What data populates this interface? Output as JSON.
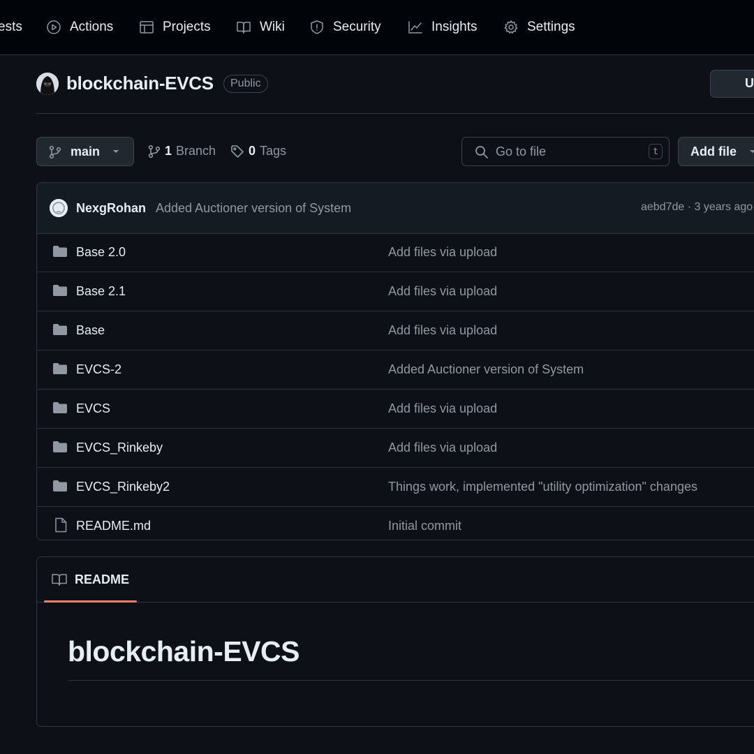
{
  "nav": {
    "items": [
      {
        "label": "ests",
        "icon": "pull-request-icon"
      },
      {
        "label": "Actions",
        "icon": "play-icon"
      },
      {
        "label": "Projects",
        "icon": "table-icon"
      },
      {
        "label": "Wiki",
        "icon": "book-icon"
      },
      {
        "label": "Security",
        "icon": "shield-icon"
      },
      {
        "label": "Insights",
        "icon": "graph-icon"
      },
      {
        "label": "Settings",
        "icon": "gear-icon"
      }
    ]
  },
  "repo": {
    "name": "blockchain-EVCS",
    "visibility": "Public",
    "pin_label": "U"
  },
  "controls": {
    "branch": "main",
    "branch_count": "1",
    "branch_label": "Branch",
    "tag_count": "0",
    "tag_label": "Tags",
    "goto_placeholder": "Go to file",
    "goto_shortcut": "t",
    "add_file": "Add file"
  },
  "latest_commit": {
    "author": "NexgRohan",
    "message": "Added Auctioner version of System",
    "meta": "aebd7de · 3 years ago"
  },
  "files": [
    {
      "name": "Base 2.0",
      "type": "folder",
      "message": "Add files via upload"
    },
    {
      "name": "Base 2.1",
      "type": "folder",
      "message": "Add files via upload"
    },
    {
      "name": "Base",
      "type": "folder",
      "message": "Add files via upload"
    },
    {
      "name": "EVCS-2",
      "type": "folder",
      "message": "Added Auctioner version of System"
    },
    {
      "name": "EVCS",
      "type": "folder",
      "message": "Add files via upload"
    },
    {
      "name": "EVCS_Rinkeby",
      "type": "folder",
      "message": "Add files via upload"
    },
    {
      "name": "EVCS_Rinkeby2",
      "type": "folder",
      "message": "Things work, implemented \"utility optimization\" changes"
    },
    {
      "name": "README.md",
      "type": "file",
      "message": "Initial commit"
    }
  ],
  "readme": {
    "tab": "README",
    "heading": "blockchain-EVCS"
  },
  "colors": {
    "background": "#0d1117",
    "nav_background": "#010409",
    "border": "#30363d",
    "text": "#e6edf3",
    "muted": "#9198a1",
    "tab_accent": "#f78166"
  }
}
